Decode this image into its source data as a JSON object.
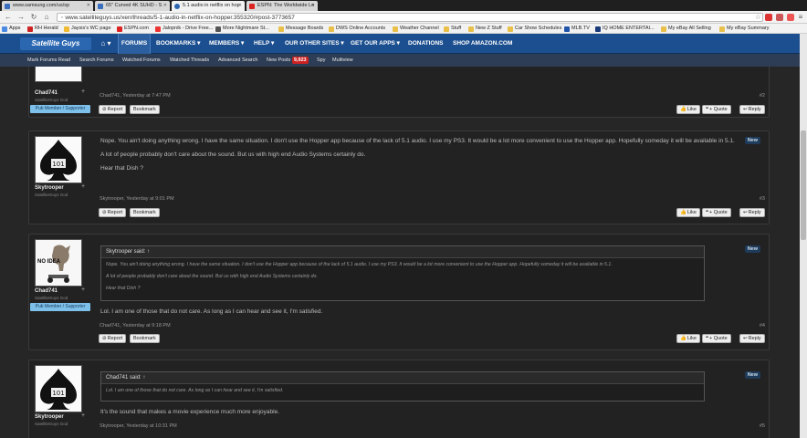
{
  "browser": {
    "tabs": [
      {
        "title": "www.samsung.com/us/sp"
      },
      {
        "title": "65\" Curved 4K SUHD - S"
      },
      {
        "title": "5.1 audio in netflix on hop"
      },
      {
        "title": "ESPN: The Worldwide Le"
      }
    ],
    "url": "www.satelliteguys.us/xen/threads/5-1-audio-in-netflix-on-hopper.355320/#post-3773657",
    "bookmarks": [
      "Apps",
      "RH Herald",
      "Jaysis's WC page",
      "ESPN.com",
      "Jalopnik - Drive Free...",
      "More Nightmare St...",
      "Message Boards",
      "DWS Online Accounts",
      "Weather Channel",
      "Stuff",
      "New Z Stuff",
      "Car Show Schedules",
      "MLB.TV",
      "IQ HOME ENTERTAI...",
      "My eBay All Selling",
      "My eBay Summary"
    ]
  },
  "site": {
    "logo": "Satellite Guys",
    "nav": [
      "FORUMS",
      "BOOKMARKS ▾",
      "MEMBERS ▾",
      "HELP ▾",
      "OUR OTHER SITES ▾",
      "GET OUR APPS ▾",
      "DONATIONS",
      "SHOP AMAZON.COM"
    ],
    "subnav": [
      "Mark Forums Read",
      "Search Forums",
      "Watched Forums",
      "Watched Threads",
      "Advanced Search",
      "New Posts",
      "Spy",
      "Multiview"
    ],
    "new_posts_count": "9,923"
  },
  "posts": [
    {
      "user": "Chad741",
      "user_title": "SatelliteGuys God",
      "member_badge": "Pub Member / Supporter",
      "meta": "Chad741, Yesterday at 7:47 PM",
      "num": "#2",
      "actions": {
        "report": "Report",
        "bookmark": "Bookmark",
        "like": "Like",
        "quote": "+ Quote",
        "reply": "Reply"
      }
    },
    {
      "user": "Skytrooper",
      "user_title": "SatelliteGuys God",
      "lines": [
        "Nope. You ain't doing anything wrong. I have the same situation. I don't use the Hopper app because of the lack of 5.1 audio. I use my PS3. It would be a lot more convenient to use the Hopper app. Hopefully someday it will be available in 5.1.",
        "A lot of people probably don't care about the sound. But us with high end Audio Systems certainly do.",
        "Hear that Dish ?"
      ],
      "new": "New",
      "meta": "Skytrooper, Yesterday at 9:01 PM",
      "num": "#3",
      "actions": {
        "report": "Report",
        "bookmark": "Bookmark",
        "like": "Like",
        "quote": "+ Quote",
        "reply": "Reply"
      }
    },
    {
      "user": "Chad741",
      "user_title": "SatelliteGuys God",
      "member_badge": "Pub Member / Supporter",
      "avatar_text": "NO IDEA",
      "quote_head": "Skytrooper said: ↑",
      "quote_lines": [
        "Nope. You ain't doing anything wrong. I have the same situation. I don't use the Hopper app because of the lack of 5.1 audio. I use my PS3. It would be a lot more convenient to use the Hopper app. Hopefully someday it will be available in 5.1.",
        "A lot of people probably don't care about the sound. But us with high end Audio Systems certainly do.",
        "Hear that Dish ?"
      ],
      "text": "Lol. I am one of those that do not care. As long as I can hear and see it, I'm satisfied.",
      "new": "New",
      "meta": "Chad741, Yesterday at 9:18 PM",
      "num": "#4",
      "actions": {
        "report": "Report",
        "bookmark": "Bookmark",
        "like": "Like",
        "quote": "+ Quote",
        "reply": "Reply"
      }
    },
    {
      "user": "Skytrooper",
      "user_title": "SatelliteGuys God",
      "quote_head": "Chad741 said: ↑",
      "quote_lines": [
        "Lol. I am one of those that do not care. As long as I can hear and see it, I'm satisfied."
      ],
      "text": "It's the sound that makes a movie experience much more enjoyable.",
      "new": "New",
      "meta": "Skytrooper, Yesterday at 10:31 PM",
      "num": "#5"
    }
  ]
}
